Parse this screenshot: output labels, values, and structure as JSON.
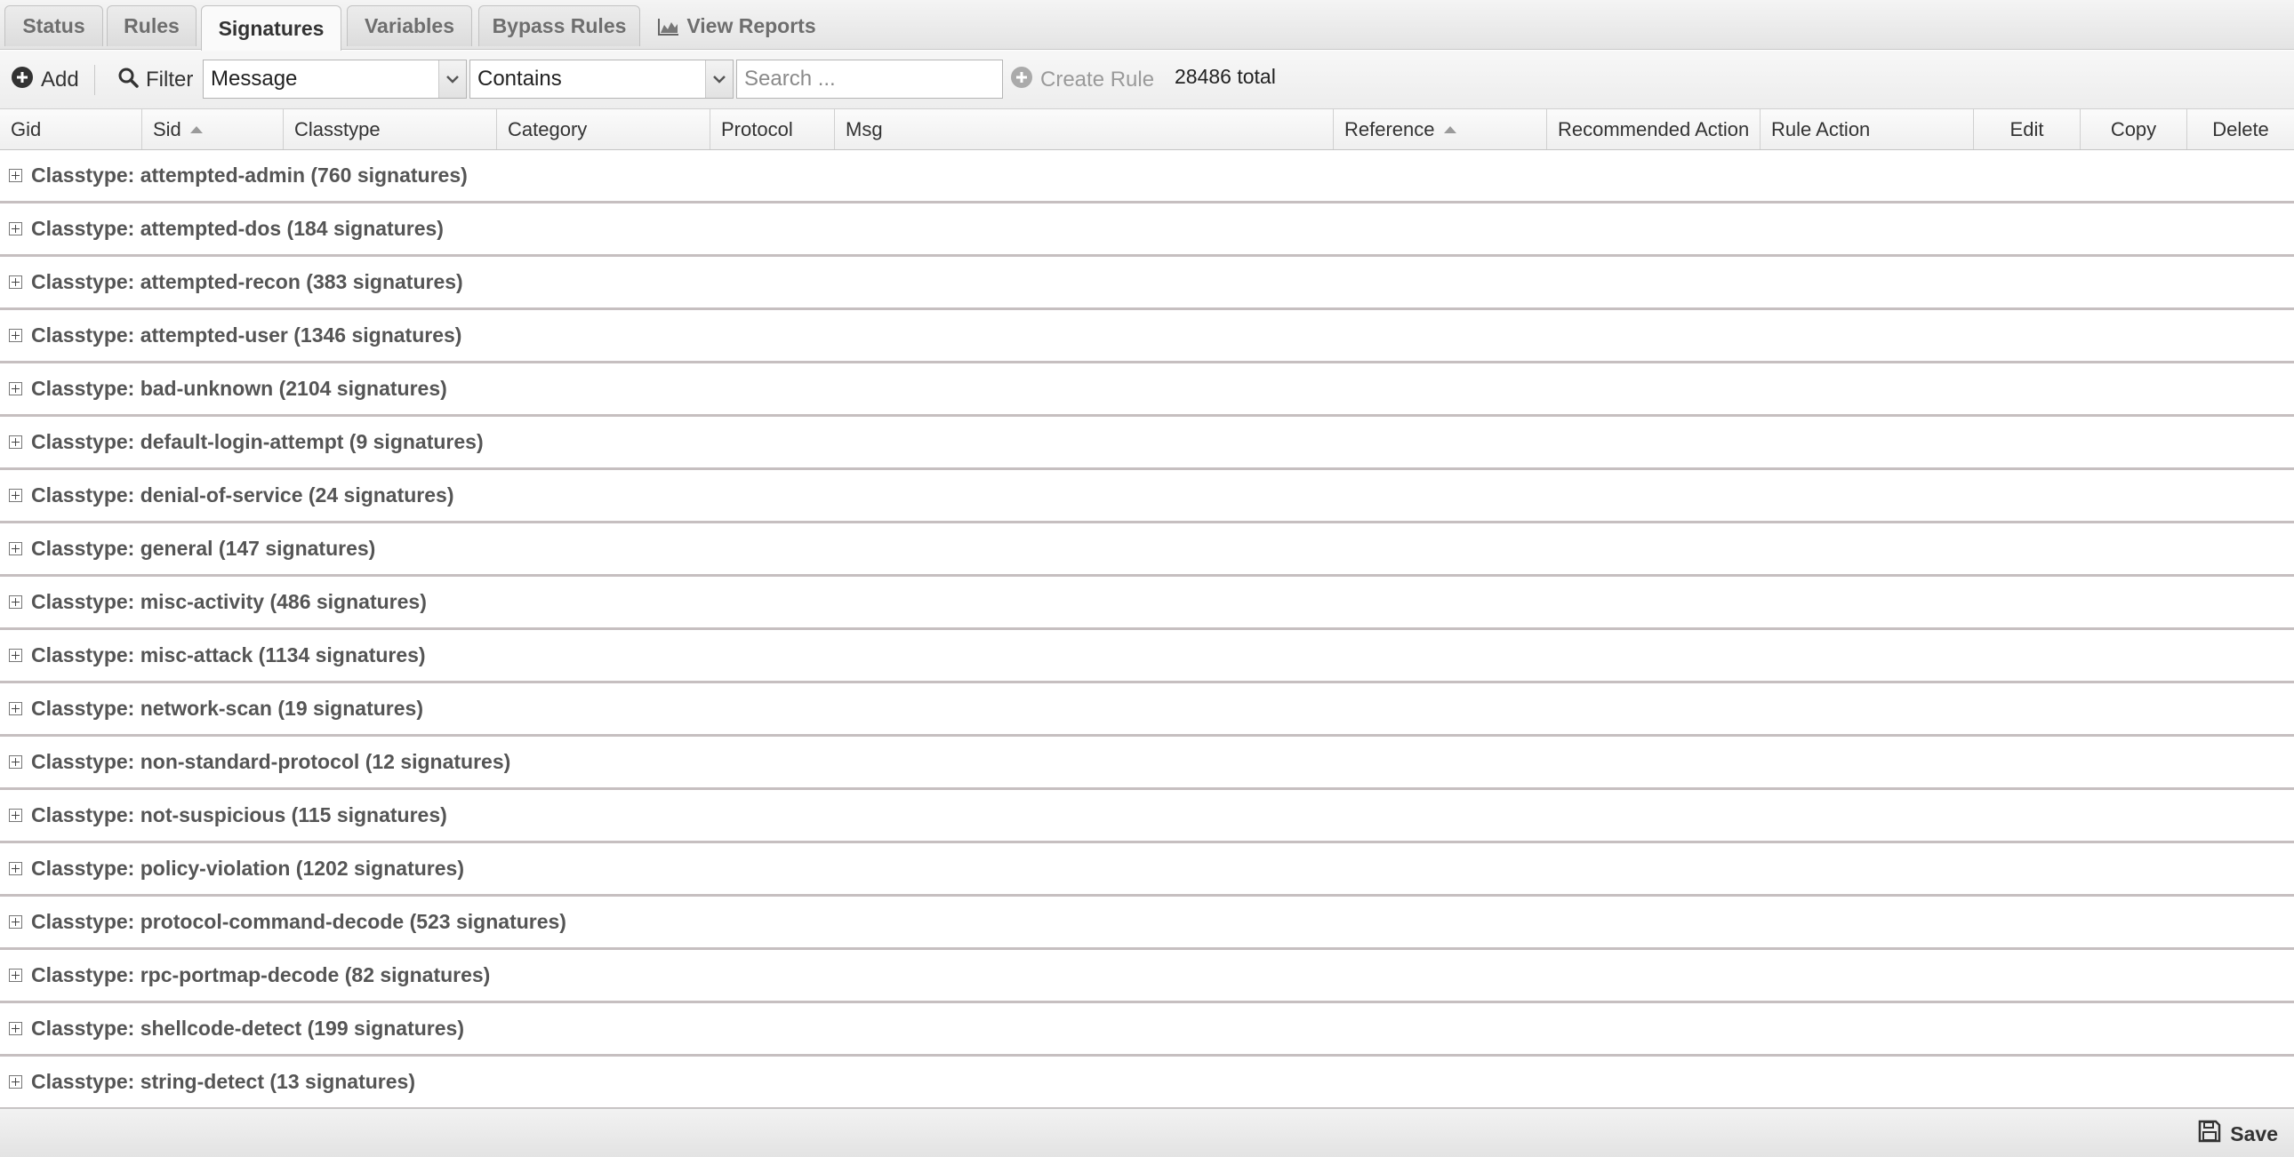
{
  "tabs": [
    {
      "label": "Status"
    },
    {
      "label": "Rules"
    },
    {
      "label": "Signatures"
    },
    {
      "label": "Variables"
    },
    {
      "label": "Bypass Rules"
    },
    {
      "label": "View Reports"
    }
  ],
  "toolbar": {
    "add_label": "Add",
    "filter_label": "Filter",
    "field_select": "Message",
    "operator_select": "Contains",
    "search_placeholder": "Search ...",
    "create_rule_label": "Create Rule",
    "total_text": "28486 total"
  },
  "columns": [
    {
      "label": "Gid"
    },
    {
      "label": "Sid"
    },
    {
      "label": "Classtype"
    },
    {
      "label": "Category"
    },
    {
      "label": "Protocol"
    },
    {
      "label": "Msg"
    },
    {
      "label": "Reference"
    },
    {
      "label": "Recommended Action"
    },
    {
      "label": "Rule Action"
    },
    {
      "label": "Edit"
    },
    {
      "label": "Copy"
    },
    {
      "label": "Delete"
    }
  ],
  "groups": [
    {
      "label": "Classtype: attempted-admin (760 signatures)"
    },
    {
      "label": "Classtype: attempted-dos (184 signatures)"
    },
    {
      "label": "Classtype: attempted-recon (383 signatures)"
    },
    {
      "label": "Classtype: attempted-user (1346 signatures)"
    },
    {
      "label": "Classtype: bad-unknown (2104 signatures)"
    },
    {
      "label": "Classtype: default-login-attempt (9 signatures)"
    },
    {
      "label": "Classtype: denial-of-service (24 signatures)"
    },
    {
      "label": "Classtype: general (147 signatures)"
    },
    {
      "label": "Classtype: misc-activity (486 signatures)"
    },
    {
      "label": "Classtype: misc-attack (1134 signatures)"
    },
    {
      "label": "Classtype: network-scan (19 signatures)"
    },
    {
      "label": "Classtype: non-standard-protocol (12 signatures)"
    },
    {
      "label": "Classtype: not-suspicious (115 signatures)"
    },
    {
      "label": "Classtype: policy-violation (1202 signatures)"
    },
    {
      "label": "Classtype: protocol-command-decode (523 signatures)"
    },
    {
      "label": "Classtype: rpc-portmap-decode (82 signatures)"
    },
    {
      "label": "Classtype: shellcode-detect (199 signatures)"
    },
    {
      "label": "Classtype: string-detect (13 signatures)"
    }
  ],
  "footer": {
    "save_label": "Save"
  }
}
